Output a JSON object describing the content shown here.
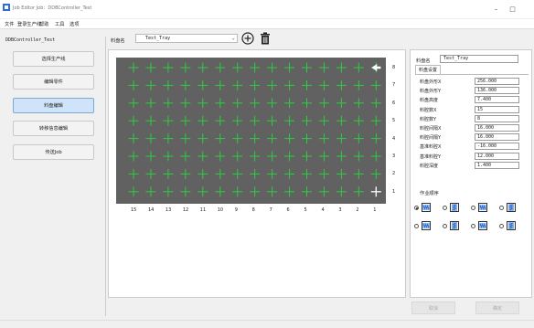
{
  "window": {
    "title": "Job Editor  Job：DDBController_Test",
    "minimize_glyph": "–",
    "maximize_glyph": "□"
  },
  "menu": [
    "文件",
    "登录生产线",
    "帮助",
    "工具",
    "选项"
  ],
  "left": {
    "title": "DDBController_Test",
    "nav": [
      "选择生产线",
      "编辑零件",
      "料盘编辑",
      "转移信息编辑",
      "传送Job"
    ],
    "active_index": 2
  },
  "tray_header": {
    "label": "料盘名",
    "selected": "Test_Tray"
  },
  "tray_grid": {
    "rows": 8,
    "cols": 15,
    "row_labels": [
      "8",
      "7",
      "6",
      "5",
      "4",
      "3",
      "2",
      "1"
    ],
    "col_labels": [
      "15",
      "14",
      "13",
      "12",
      "11",
      "10",
      "9",
      "8",
      "7",
      "6",
      "5",
      "4",
      "3",
      "2",
      "1"
    ],
    "marker_color": "#2ecc40",
    "tray_color": "#616161"
  },
  "props": {
    "name_label": "料盘名",
    "name_value": "Test_Tray",
    "tab": "料盘设置",
    "params": [
      {
        "label": "料盘外形X",
        "value": "256.000"
      },
      {
        "label": "料盘外形Y",
        "value": "136.000"
      },
      {
        "label": "料盘高度",
        "value": "7.400"
      },
      {
        "label": "料腔数X",
        "value": "15"
      },
      {
        "label": "料腔数Y",
        "value": "8"
      },
      {
        "label": "料腔间隔X",
        "value": "16.000"
      },
      {
        "label": "料腔间隔Y",
        "value": "16.000"
      },
      {
        "label": "基准料腔X",
        "value": "-16.000"
      },
      {
        "label": "基准料腔Y",
        "value": "12.000"
      },
      {
        "label": "料腔深度",
        "value": "1.400"
      }
    ],
    "order_label": "作业顺序",
    "order_selected_index": 0
  },
  "buttons": {
    "ok": "取消",
    "confirm": "确定"
  }
}
